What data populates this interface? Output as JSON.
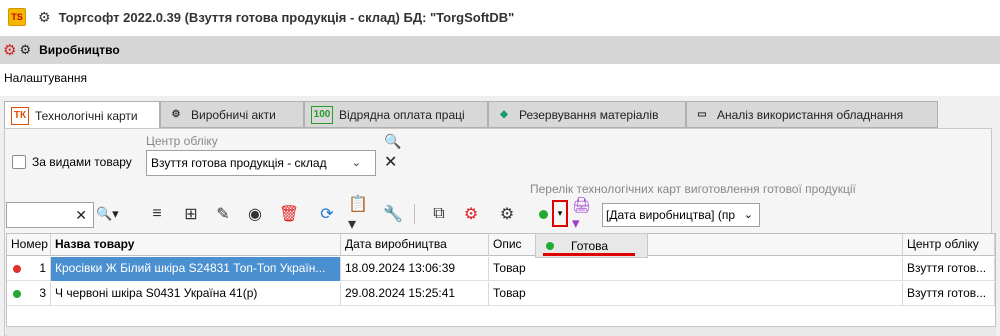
{
  "window": {
    "app_icon_text": "TS",
    "title": "Торгсофт 2022.0.39 (Взуття готова продукція - склад) БД: \"TorgSoftDB\""
  },
  "module": {
    "title": "Виробництво"
  },
  "menu": {
    "settings": "Налаштування"
  },
  "tabs": [
    {
      "label": "Технологічні карти",
      "icon": "tk-icon",
      "icon_text": "ТК",
      "active": true
    },
    {
      "label": "Виробничі акти",
      "icon": "gear-icon"
    },
    {
      "label": "Відрядна оплата праці",
      "icon": "money-icon",
      "icon_text": "100"
    },
    {
      "label": "Резервування матеріалів",
      "icon": "layers-icon"
    },
    {
      "label": "Аналіз використання обладнання",
      "icon": "monitor-icon"
    }
  ],
  "filters": {
    "by_goods_type_label": "За видами товару",
    "by_goods_type_checked": false,
    "accounting_center_label": "Центр обліку",
    "accounting_center_value": "Взуття готова продукція - склад"
  },
  "list_caption": "Перелік технологічних карт виготовлення готової продукції",
  "search": {
    "value": ""
  },
  "sort": {
    "value": "[Дата виробництва] (пр"
  },
  "status_filter": {
    "selected": "Готова",
    "color": "#22aa33"
  },
  "grid": {
    "columns": [
      "Номер",
      "Назва товару",
      "Дата виробництва",
      "Опис",
      "Центр обліку"
    ],
    "rows": [
      {
        "status_color": "#e03030",
        "number": "1",
        "name": "Кросівки Ж Білий шкіра S24831 Топ-Топ Україн...",
        "date": "18.09.2024 13:06:39",
        "description": "Товар",
        "center": "Взуття готов...",
        "selected": true
      },
      {
        "status_color": "#22aa33",
        "number": "3",
        "name": "Ч червоні шкіра S0431 Україна 41(р)",
        "date": "29.08.2024 15:25:41",
        "description": "Товар",
        "center": "Взуття готов...",
        "selected": false
      }
    ]
  }
}
